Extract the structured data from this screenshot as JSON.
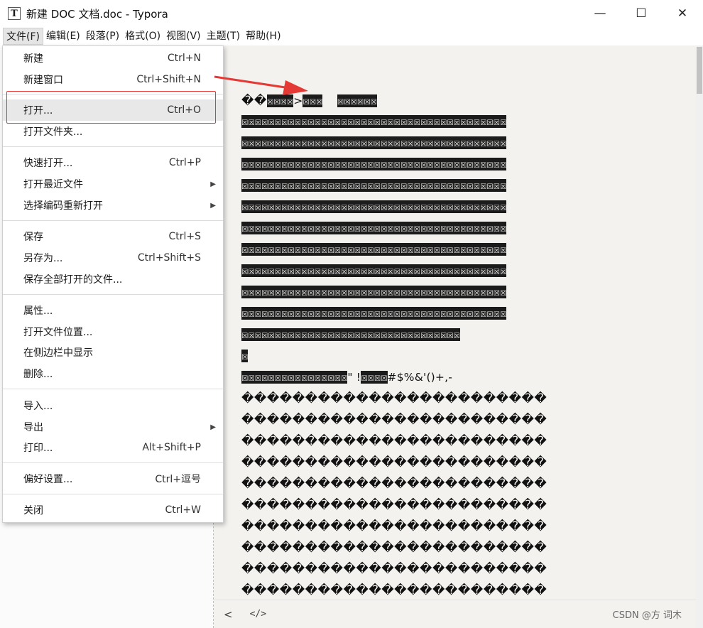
{
  "window": {
    "app_icon": "T",
    "title": "新建 DOC 文档.doc - Typora",
    "minimize": "—",
    "maximize": "☐",
    "close": "✕"
  },
  "menubar": [
    "文件(F)",
    "编辑(E)",
    "段落(P)",
    "格式(O)",
    "视图(V)",
    "主题(T)",
    "帮助(H)"
  ],
  "file_menu": {
    "new": {
      "label": "新建",
      "shortcut": "Ctrl+N"
    },
    "new_window": {
      "label": "新建窗口",
      "shortcut": "Ctrl+Shift+N"
    },
    "open": {
      "label": "打开...",
      "shortcut": "Ctrl+O"
    },
    "open_folder": {
      "label": "打开文件夹..."
    },
    "quick_open": {
      "label": "快速打开...",
      "shortcut": "Ctrl+P"
    },
    "open_recent": {
      "label": "打开最近文件"
    },
    "reopen_encoding": {
      "label": "选择编码重新打开"
    },
    "save": {
      "label": "保存",
      "shortcut": "Ctrl+S"
    },
    "save_as": {
      "label": "另存为...",
      "shortcut": "Ctrl+Shift+S"
    },
    "save_all": {
      "label": "保存全部打开的文件..."
    },
    "properties": {
      "label": "属性..."
    },
    "open_location": {
      "label": "打开文件位置..."
    },
    "show_in_sidebar": {
      "label": "在侧边栏中显示"
    },
    "delete": {
      "label": "删除..."
    },
    "import": {
      "label": "导入..."
    },
    "export": {
      "label": "导出"
    },
    "print": {
      "label": "打印...",
      "shortcut": "Alt+Shift+P"
    },
    "preferences": {
      "label": "偏好设置...",
      "shortcut": "Ctrl+逗号"
    },
    "close": {
      "label": "关闭",
      "shortcut": "Ctrl+W"
    }
  },
  "editor": {
    "line1_a": "��",
    "line1_b": "☒☒☒☒",
    "line1_c": ">",
    "line1_d": "☒☒☒",
    "line1_e": "☒☒☒☒☒☒",
    "box_row": "☒☒☒☒☒☒☒☒☒☒☒☒☒☒☒☒☒☒☒☒☒☒☒☒☒☒☒☒☒☒☒☒☒☒☒☒☒☒☒☒",
    "box_row_short": "☒☒☒☒☒☒☒☒☒☒☒☒☒☒☒☒☒☒☒☒☒☒☒☒☒☒☒☒☒☒☒☒☒",
    "box_single": "☒",
    "line_mixed_a": "☒☒☒☒☒☒☒☒☒☒☒☒☒☒☒☒",
    "line_mixed_b": "\" !",
    "line_mixed_c": "☒☒☒☒",
    "line_mixed_d": "#$%&'()+,-",
    "bad_row": "������������������������"
  },
  "footer": {
    "back": "<",
    "source": "</>",
    "stats": "CSDN @方 词木"
  },
  "colors": {
    "annotation_red": "#e53935",
    "editor_bg": "#f3f2ef"
  }
}
